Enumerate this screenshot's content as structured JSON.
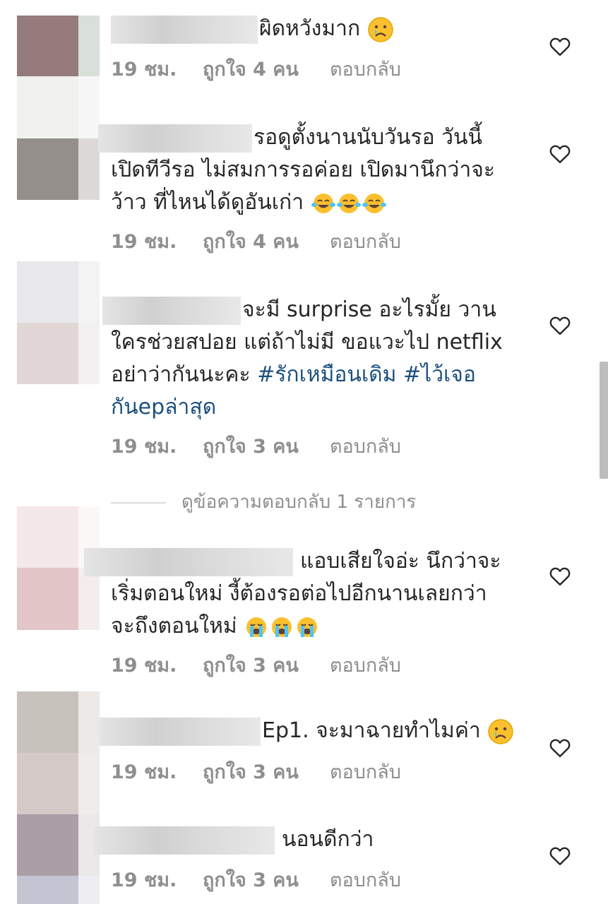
{
  "comments": [
    {
      "lines": [
        "ผิดหวังมาก"
      ],
      "time": "19 ชม.",
      "likes": "ถูกใจ 4 คน",
      "reply": "ตอบกลับ",
      "emoji": "sad-tear-emoji"
    },
    {
      "lines": [
        "รอดูตั้งนานนับวันรอ วันนี้",
        "เปิดทีวีรอ ไม่สมการรอค่อย เปิดมานึกว่าจะ",
        "ว้าว ที่ไหนได้ดูอันเก่า"
      ],
      "time": "19 ชม.",
      "likes": "ถูกใจ 4 คน",
      "reply": "ตอบกลับ",
      "emoji": "tears-of-joy-emoji"
    },
    {
      "lines": [
        "จะมี surprise อะไรมั้ย วาน",
        "ใครช่วยสปอย แต่ถ้าไม่มี ขอแวะไป netflix",
        "อย่าว่ากันนะคะ",
        "กันepล่าสุด"
      ],
      "hashtags": [
        "#รักเหมือนเดิม",
        "#ไว้เจอ"
      ],
      "time": "19 ชม.",
      "likes": "ถูกใจ 3 คน",
      "reply": "ตอบกลับ"
    },
    {
      "lines": [
        "แอบเสียใจอ่ะ นึกว่าจะ",
        "เริ่มตอนใหม่ งี้ต้องรอต่อไปอีกนานเลยกว่า",
        "จะถึงตอนใหม่"
      ],
      "time": "19 ชม.",
      "likes": "ถูกใจ 3 คน",
      "reply": "ตอบกลับ",
      "emoji": "loudly-crying-emoji"
    },
    {
      "lines": [
        "Ep1. จะมาฉายทำไมค่า"
      ],
      "time": "19 ชม.",
      "likes": "ถูกใจ 3 คน",
      "reply": "ตอบกลับ",
      "emoji": "sad-tear-emoji"
    },
    {
      "lines": [
        "นอนดีกว่า"
      ],
      "time": "19 ชม.",
      "likes": "ถูกใจ 3 คน",
      "reply": "ตอบกลับ"
    }
  ],
  "view_replies": "ดูข้อความตอบกลับ 1 รายการ",
  "colors": {
    "text": "#262626",
    "meta": "#8e8e8e",
    "hashtag": "#1b4f7f",
    "emoji_yellow": "#fbc02d"
  }
}
